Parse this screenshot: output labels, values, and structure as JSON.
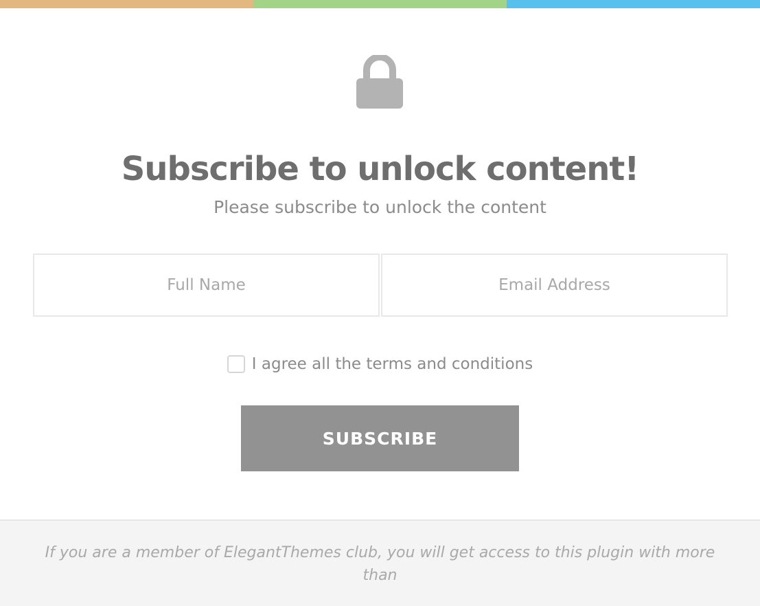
{
  "colors": {
    "bar_orange": "#e3b87e",
    "bar_green": "#a2d387",
    "bar_blue": "#58c0ec",
    "lock": "#b3b3b3",
    "button": "#929292"
  },
  "icon": {
    "name": "lock-icon"
  },
  "headline": "Subscribe to unlock content!",
  "subheadline": "Please subscribe to unlock the content",
  "form": {
    "name_placeholder": "Full Name",
    "name_value": "",
    "email_placeholder": "Email Address",
    "email_value": "",
    "agree_label": "I agree all the terms and conditions",
    "agree_checked": false,
    "submit_label": "SUBSCRIBE"
  },
  "footer": {
    "text": "If you are a member of ElegantThemes club, you will get access to this plugin with more than"
  }
}
